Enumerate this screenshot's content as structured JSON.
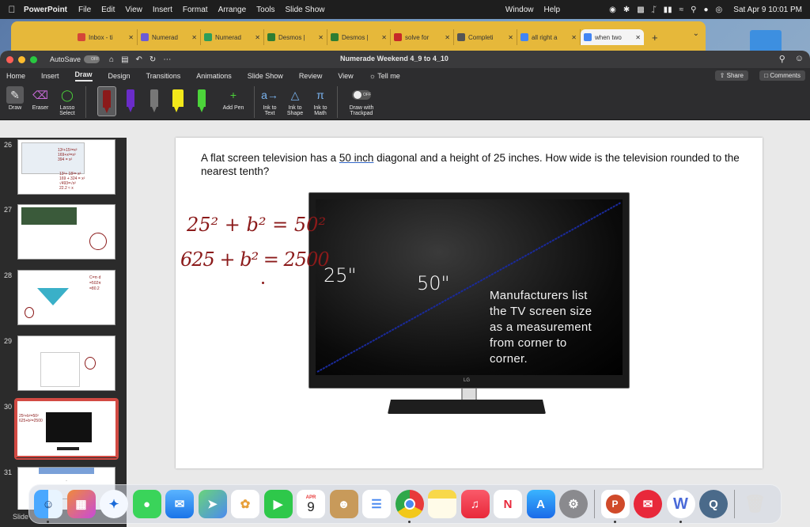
{
  "menubar": {
    "app_name": "PowerPoint",
    "menus": [
      "File",
      "Edit",
      "View",
      "Insert",
      "Format",
      "Arrange",
      "Tools",
      "Slide Show",
      "Window",
      "Help"
    ],
    "datetime": "Sat Apr 9  10:01 PM"
  },
  "browser": {
    "tabs": [
      {
        "label": "Inbox - ti",
        "color": "#d44638"
      },
      {
        "label": "Numerad",
        "color": "#6b5bd6"
      },
      {
        "label": "Numerad",
        "color": "#2e9e5a"
      },
      {
        "label": "Desmos |",
        "color": "#2e7d32"
      },
      {
        "label": "Desmos |",
        "color": "#2e7d32"
      },
      {
        "label": "solve for",
        "color": "#c62828"
      },
      {
        "label": "Completi",
        "color": "#555555"
      },
      {
        "label": "all right a",
        "color": "#4285f4"
      },
      {
        "label": "when two",
        "color": "#4285f4"
      }
    ]
  },
  "window": {
    "autosave_label": "AutoSave",
    "autosave_state": "OFF",
    "doc_title": "Numerade Weekend 4_9 to 4_10"
  },
  "ribbon": {
    "tabs": [
      "Home",
      "Insert",
      "Draw",
      "Design",
      "Transitions",
      "Animations",
      "Slide Show",
      "Review",
      "View",
      "Tell me"
    ],
    "active_tab": "Draw",
    "share": "Share",
    "comments": "Comments",
    "tools": {
      "draw": "Draw",
      "eraser": "Eraser",
      "lasso": "Lasso Select",
      "add_pen": "Add Pen",
      "ink_to_text": "Ink to Text",
      "ink_to_shape": "Ink to Shape",
      "ink_to_math": "Ink to Math",
      "trackpad": "Draw with Trackpad",
      "trackpad_state": "OFF"
    },
    "pen_colors": [
      "#8b1a1a",
      "#6a2cc8",
      "#555555",
      "#f2e81a",
      "#4cd43a"
    ]
  },
  "thumbnails": {
    "numbers": [
      "26",
      "27",
      "28",
      "29",
      "30",
      "31"
    ],
    "selected": "30"
  },
  "slide": {
    "question_before": "A flat screen television has a ",
    "question_link": "50 inch",
    "question_after": " diagonal and a height of 25 inches. How wide is the television rounded to the nearest tenth?",
    "tv_caption_lines": [
      "Manufacturers list",
      "the TV screen size",
      "as a measurement",
      "from corner to",
      "corner."
    ],
    "tv_brand": "LG",
    "label_height": "25\"",
    "label_diagonal": "50\"",
    "ink_line1": "25² + b² = 50²",
    "ink_line2": "625 + b² = 2500"
  },
  "status": {
    "text": "Slide"
  },
  "dock": {
    "calendar_month": "APR",
    "calendar_day": "9"
  }
}
